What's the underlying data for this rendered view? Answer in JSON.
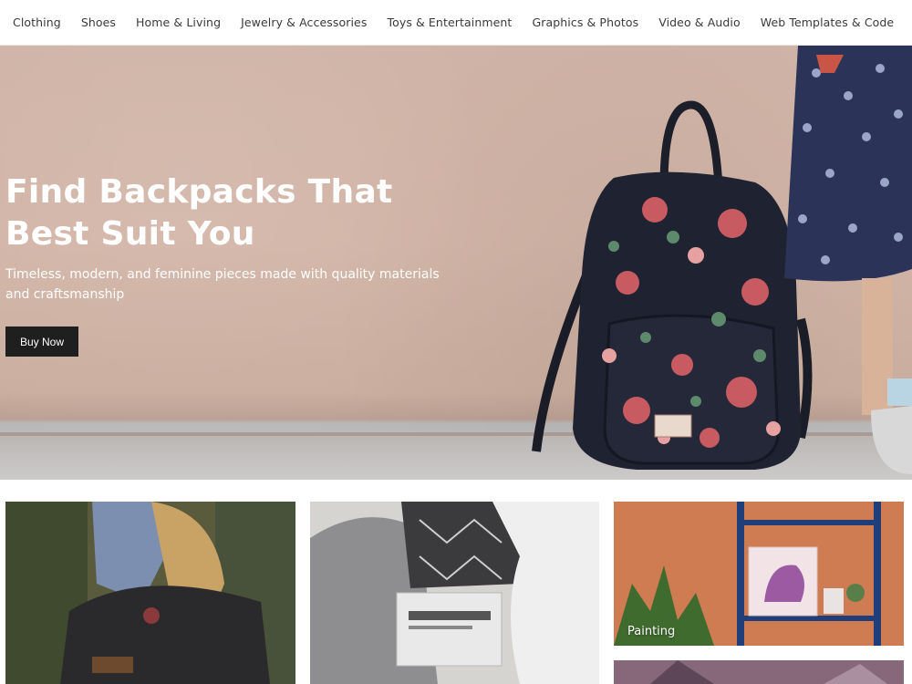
{
  "nav": {
    "items": [
      {
        "label": "Clothing"
      },
      {
        "label": "Shoes"
      },
      {
        "label": "Home & Living"
      },
      {
        "label": "Jewelry & Accessories"
      },
      {
        "label": "Toys & Entertainment"
      },
      {
        "label": "Graphics & Photos"
      },
      {
        "label": "Video & Audio"
      },
      {
        "label": "Web Templates & Code"
      }
    ]
  },
  "hero": {
    "title": "Find Backpacks That Best Suit You",
    "subtitle": "Timeless, modern, and feminine pieces made with quality materials and craftsmanship",
    "button_label": "Buy Now"
  },
  "tiles": [
    {
      "label": ""
    },
    {
      "label": ""
    },
    {
      "label": "Painting"
    },
    {
      "label": ""
    }
  ],
  "colors": {
    "button_bg": "#1f1f1f",
    "hero_wall": "#d2b5a7"
  }
}
